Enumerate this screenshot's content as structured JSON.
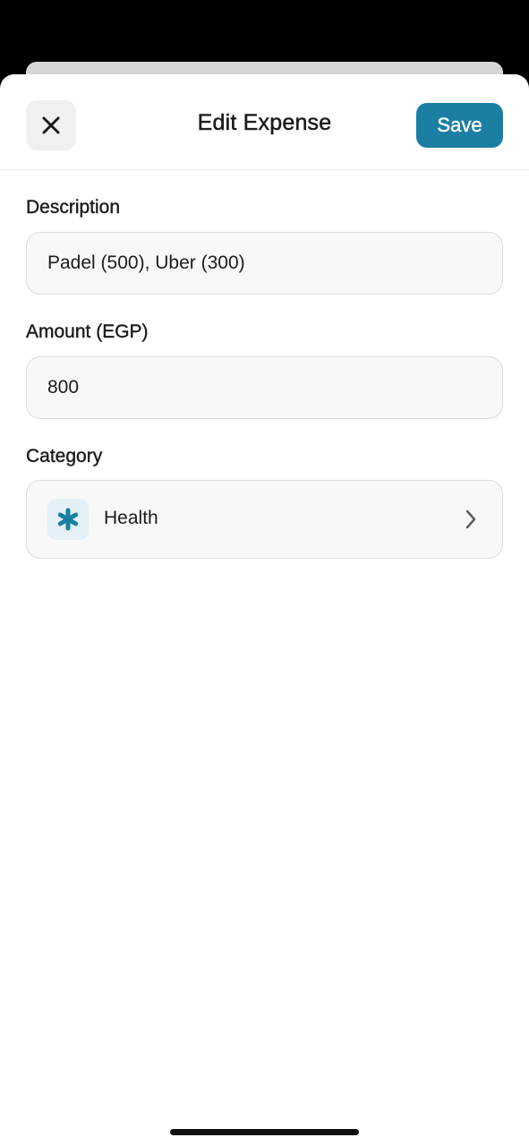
{
  "header": {
    "title": "Edit Expense",
    "save_label": "Save",
    "close_icon": "close-icon"
  },
  "form": {
    "description": {
      "label": "Description",
      "value": "Padel (500), Uber (300)"
    },
    "amount": {
      "label": "Amount (EGP)",
      "value": "800"
    },
    "category": {
      "label": "Category",
      "value": "Health",
      "icon": "asterisk-icon",
      "chevron_icon": "chevron-right-icon"
    }
  },
  "colors": {
    "accent": "#1a7fa3",
    "category_icon": "#1a7fa3",
    "category_icon_bg": "#e3f0f5",
    "field_bg": "#f8f8f9",
    "field_border": "#dcdce0"
  }
}
